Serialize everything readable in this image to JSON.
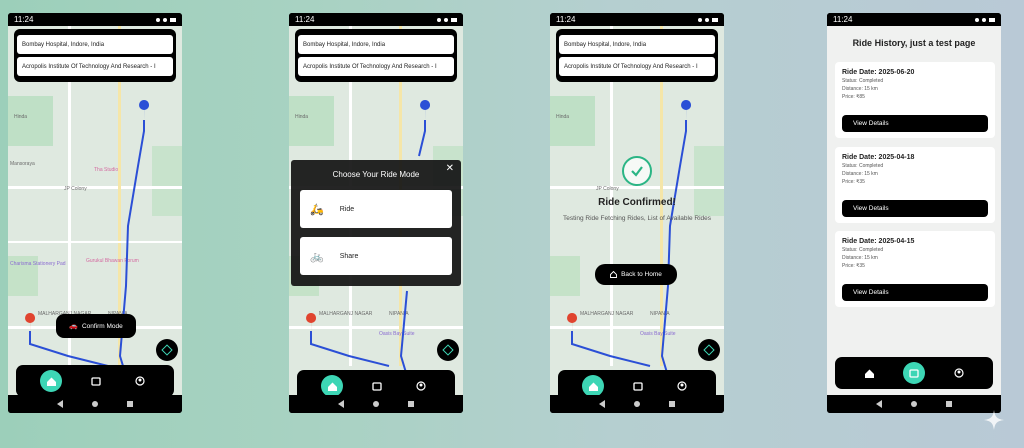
{
  "status": {
    "time": "11:24"
  },
  "addresses": {
    "from": "Bombay Hospital, Indore, India",
    "to": "Acropolis Institute Of Technology And Research - I"
  },
  "map_labels": {
    "hinda": "Hinda",
    "mansoraya": "Mansoraya",
    "the_studio": "Tha Studio",
    "jp_colony": "JP Colony",
    "vijay": "Vijay",
    "charisma": "Charisma Stationery Pad",
    "gurukul": "Gurukul Bhawan Forum",
    "malhar": "MALHARGANJ NAGAR",
    "nipania": "NIPANIA",
    "oasis": "Oasis Bay Suite"
  },
  "screen1": {
    "confirm_label": "Confirm Mode"
  },
  "screen2": {
    "modal_title": "Choose Your Ride Mode",
    "close": "✕",
    "options": [
      {
        "label": "Ride",
        "icon": "🛵"
      },
      {
        "label": "Share",
        "icon": "🚲"
      }
    ]
  },
  "screen3": {
    "title": "Ride Confirmed!",
    "subtitle": "Testing Ride Fetching Rides, List of Available Rides",
    "back_label": "Back to Home"
  },
  "screen4": {
    "title": "Ride History, just a test page",
    "cards": [
      {
        "date": "Ride Date: 2025-06-20",
        "status": "Status: Completed",
        "distance": "Distance: 15 km",
        "price": "Price: ₹85",
        "button": "View Details"
      },
      {
        "date": "Ride Date: 2025-04-18",
        "status": "Status: Completed",
        "distance": "Distance: 15 km",
        "price": "Price: ₹35",
        "button": "View Details"
      },
      {
        "date": "Ride Date: 2025-04-15",
        "status": "Status: Completed",
        "distance": "Distance: 15 km",
        "price": "Price: ₹35",
        "button": "View Details"
      }
    ]
  },
  "colors": {
    "accent": "#3dd6b5",
    "route": "#2b4fd6",
    "pin_dest": "#2b4fd6",
    "pin_origin": "#e0442f"
  },
  "icons": {
    "home": "home-icon",
    "ride": "ride-icon",
    "profile": "profile-icon"
  }
}
